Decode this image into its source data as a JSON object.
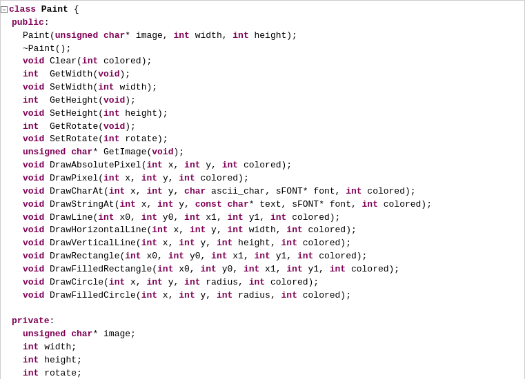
{
  "code": {
    "lines": [
      {
        "indent": 0,
        "collapse": true,
        "content": [
          {
            "t": "kw",
            "v": "class "
          },
          {
            "t": "class-name",
            "v": "Paint"
          },
          {
            "t": "plain",
            "v": " {"
          }
        ]
      },
      {
        "indent": 1,
        "content": [
          {
            "t": "kw",
            "v": "public"
          },
          {
            "t": "plain",
            "v": ":"
          }
        ]
      },
      {
        "indent": 2,
        "content": [
          {
            "t": "plain",
            "v": "Paint("
          },
          {
            "t": "kw",
            "v": "unsigned "
          },
          {
            "t": "kw",
            "v": "char"
          },
          {
            "t": "plain",
            "v": "* image, "
          },
          {
            "t": "kw",
            "v": "int"
          },
          {
            "t": "plain",
            "v": " width, "
          },
          {
            "t": "kw",
            "v": "int"
          },
          {
            "t": "plain",
            "v": " height);"
          }
        ]
      },
      {
        "indent": 2,
        "content": [
          {
            "t": "plain",
            "v": "~Paint();"
          }
        ]
      },
      {
        "indent": 2,
        "content": [
          {
            "t": "kw",
            "v": "void"
          },
          {
            "t": "plain",
            "v": " Clear("
          },
          {
            "t": "kw",
            "v": "int"
          },
          {
            "t": "plain",
            "v": " colored);"
          }
        ]
      },
      {
        "indent": 2,
        "content": [
          {
            "t": "kw",
            "v": "int"
          },
          {
            "t": "plain",
            "v": "  GetWidth("
          },
          {
            "t": "kw",
            "v": "void"
          },
          {
            "t": "plain",
            "v": ");"
          }
        ]
      },
      {
        "indent": 2,
        "content": [
          {
            "t": "kw",
            "v": "void"
          },
          {
            "t": "plain",
            "v": " SetWidth("
          },
          {
            "t": "kw",
            "v": "int"
          },
          {
            "t": "plain",
            "v": " width);"
          }
        ]
      },
      {
        "indent": 2,
        "content": [
          {
            "t": "kw",
            "v": "int"
          },
          {
            "t": "plain",
            "v": "  GetHeight("
          },
          {
            "t": "kw",
            "v": "void"
          },
          {
            "t": "plain",
            "v": ");"
          }
        ]
      },
      {
        "indent": 2,
        "content": [
          {
            "t": "kw",
            "v": "void"
          },
          {
            "t": "plain",
            "v": " SetHeight("
          },
          {
            "t": "kw",
            "v": "int"
          },
          {
            "t": "plain",
            "v": " height);"
          }
        ]
      },
      {
        "indent": 2,
        "content": [
          {
            "t": "kw",
            "v": "int"
          },
          {
            "t": "plain",
            "v": "  GetRotate("
          },
          {
            "t": "kw",
            "v": "void"
          },
          {
            "t": "plain",
            "v": ");"
          }
        ]
      },
      {
        "indent": 2,
        "content": [
          {
            "t": "kw",
            "v": "void"
          },
          {
            "t": "plain",
            "v": " SetRotate("
          },
          {
            "t": "kw",
            "v": "int"
          },
          {
            "t": "plain",
            "v": " rotate);"
          }
        ]
      },
      {
        "indent": 2,
        "content": [
          {
            "t": "kw",
            "v": "unsigned "
          },
          {
            "t": "kw",
            "v": "char"
          },
          {
            "t": "plain",
            "v": "* GetImage("
          },
          {
            "t": "kw",
            "v": "void"
          },
          {
            "t": "plain",
            "v": ");"
          }
        ]
      },
      {
        "indent": 2,
        "content": [
          {
            "t": "kw",
            "v": "void"
          },
          {
            "t": "plain",
            "v": " DrawAbsolutePixel("
          },
          {
            "t": "kw",
            "v": "int"
          },
          {
            "t": "plain",
            "v": " x, "
          },
          {
            "t": "kw",
            "v": "int"
          },
          {
            "t": "plain",
            "v": " y, "
          },
          {
            "t": "kw",
            "v": "int"
          },
          {
            "t": "plain",
            "v": " colored);"
          }
        ]
      },
      {
        "indent": 2,
        "content": [
          {
            "t": "kw",
            "v": "void"
          },
          {
            "t": "plain",
            "v": " DrawPixel("
          },
          {
            "t": "kw",
            "v": "int"
          },
          {
            "t": "plain",
            "v": " x, "
          },
          {
            "t": "kw",
            "v": "int"
          },
          {
            "t": "plain",
            "v": " y, "
          },
          {
            "t": "kw",
            "v": "int"
          },
          {
            "t": "plain",
            "v": " colored);"
          }
        ]
      },
      {
        "indent": 2,
        "content": [
          {
            "t": "kw",
            "v": "void"
          },
          {
            "t": "plain",
            "v": " DrawCharAt("
          },
          {
            "t": "kw",
            "v": "int"
          },
          {
            "t": "plain",
            "v": " x, "
          },
          {
            "t": "kw",
            "v": "int"
          },
          {
            "t": "plain",
            "v": " y, "
          },
          {
            "t": "kw",
            "v": "char"
          },
          {
            "t": "plain",
            "v": " ascii_char, sFONT* font, "
          },
          {
            "t": "kw",
            "v": "int"
          },
          {
            "t": "plain",
            "v": " colored);"
          }
        ]
      },
      {
        "indent": 2,
        "content": [
          {
            "t": "kw",
            "v": "void"
          },
          {
            "t": "plain",
            "v": " DrawStringAt("
          },
          {
            "t": "kw",
            "v": "int"
          },
          {
            "t": "plain",
            "v": " x, "
          },
          {
            "t": "kw",
            "v": "int"
          },
          {
            "t": "plain",
            "v": " y, "
          },
          {
            "t": "kw",
            "v": "const "
          },
          {
            "t": "kw",
            "v": "char"
          },
          {
            "t": "plain",
            "v": "* text, sFONT* font, "
          },
          {
            "t": "kw",
            "v": "int"
          },
          {
            "t": "plain",
            "v": " colored);"
          }
        ]
      },
      {
        "indent": 2,
        "content": [
          {
            "t": "kw",
            "v": "void"
          },
          {
            "t": "plain",
            "v": " DrawLine("
          },
          {
            "t": "kw",
            "v": "int"
          },
          {
            "t": "plain",
            "v": " x0, "
          },
          {
            "t": "kw",
            "v": "int"
          },
          {
            "t": "plain",
            "v": " y0, "
          },
          {
            "t": "kw",
            "v": "int"
          },
          {
            "t": "plain",
            "v": " x1, "
          },
          {
            "t": "kw",
            "v": "int"
          },
          {
            "t": "plain",
            "v": " y1, "
          },
          {
            "t": "kw",
            "v": "int"
          },
          {
            "t": "plain",
            "v": " colored);"
          }
        ]
      },
      {
        "indent": 2,
        "content": [
          {
            "t": "kw",
            "v": "void"
          },
          {
            "t": "plain",
            "v": " DrawHorizontalLine("
          },
          {
            "t": "kw",
            "v": "int"
          },
          {
            "t": "plain",
            "v": " x, "
          },
          {
            "t": "kw",
            "v": "int"
          },
          {
            "t": "plain",
            "v": " y, "
          },
          {
            "t": "kw",
            "v": "int"
          },
          {
            "t": "plain",
            "v": " width, "
          },
          {
            "t": "kw",
            "v": "int"
          },
          {
            "t": "plain",
            "v": " colored);"
          }
        ]
      },
      {
        "indent": 2,
        "content": [
          {
            "t": "kw",
            "v": "void"
          },
          {
            "t": "plain",
            "v": " DrawVerticalLine("
          },
          {
            "t": "kw",
            "v": "int"
          },
          {
            "t": "plain",
            "v": " x, "
          },
          {
            "t": "kw",
            "v": "int"
          },
          {
            "t": "plain",
            "v": " y, "
          },
          {
            "t": "kw",
            "v": "int"
          },
          {
            "t": "plain",
            "v": " height, "
          },
          {
            "t": "kw",
            "v": "int"
          },
          {
            "t": "plain",
            "v": " colored);"
          }
        ]
      },
      {
        "indent": 2,
        "content": [
          {
            "t": "kw",
            "v": "void"
          },
          {
            "t": "plain",
            "v": " DrawRectangle("
          },
          {
            "t": "kw",
            "v": "int"
          },
          {
            "t": "plain",
            "v": " x0, "
          },
          {
            "t": "kw",
            "v": "int"
          },
          {
            "t": "plain",
            "v": " y0, "
          },
          {
            "t": "kw",
            "v": "int"
          },
          {
            "t": "plain",
            "v": " x1, "
          },
          {
            "t": "kw",
            "v": "int"
          },
          {
            "t": "plain",
            "v": " y1, "
          },
          {
            "t": "kw",
            "v": "int"
          },
          {
            "t": "plain",
            "v": " colored);"
          }
        ]
      },
      {
        "indent": 2,
        "content": [
          {
            "t": "kw",
            "v": "void"
          },
          {
            "t": "plain",
            "v": " DrawFilledRectangle("
          },
          {
            "t": "kw",
            "v": "int"
          },
          {
            "t": "plain",
            "v": " x0, "
          },
          {
            "t": "kw",
            "v": "int"
          },
          {
            "t": "plain",
            "v": " y0, "
          },
          {
            "t": "kw",
            "v": "int"
          },
          {
            "t": "plain",
            "v": " x1, "
          },
          {
            "t": "kw",
            "v": "int"
          },
          {
            "t": "plain",
            "v": " y1, "
          },
          {
            "t": "kw",
            "v": "int"
          },
          {
            "t": "plain",
            "v": " colored);"
          }
        ]
      },
      {
        "indent": 2,
        "content": [
          {
            "t": "kw",
            "v": "void"
          },
          {
            "t": "plain",
            "v": " DrawCircle("
          },
          {
            "t": "kw",
            "v": "int"
          },
          {
            "t": "plain",
            "v": " x, "
          },
          {
            "t": "kw",
            "v": "int"
          },
          {
            "t": "plain",
            "v": " y, "
          },
          {
            "t": "kw",
            "v": "int"
          },
          {
            "t": "plain",
            "v": " radius, "
          },
          {
            "t": "kw",
            "v": "int"
          },
          {
            "t": "plain",
            "v": " colored);"
          }
        ]
      },
      {
        "indent": 2,
        "content": [
          {
            "t": "kw",
            "v": "void"
          },
          {
            "t": "plain",
            "v": " DrawFilledCircle("
          },
          {
            "t": "kw",
            "v": "int"
          },
          {
            "t": "plain",
            "v": " x, "
          },
          {
            "t": "kw",
            "v": "int"
          },
          {
            "t": "plain",
            "v": " y, "
          },
          {
            "t": "kw",
            "v": "int"
          },
          {
            "t": "plain",
            "v": " radius, "
          },
          {
            "t": "kw",
            "v": "int"
          },
          {
            "t": "plain",
            "v": " colored);"
          }
        ]
      },
      {
        "indent": 0,
        "content": []
      },
      {
        "indent": 1,
        "content": [
          {
            "t": "kw",
            "v": "private"
          },
          {
            "t": "plain",
            "v": ":"
          }
        ]
      },
      {
        "indent": 2,
        "content": [
          {
            "t": "kw",
            "v": "unsigned "
          },
          {
            "t": "kw",
            "v": "char"
          },
          {
            "t": "plain",
            "v": "* image;"
          }
        ]
      },
      {
        "indent": 2,
        "content": [
          {
            "t": "kw",
            "v": "int"
          },
          {
            "t": "plain",
            "v": " width;"
          }
        ]
      },
      {
        "indent": 2,
        "content": [
          {
            "t": "kw",
            "v": "int"
          },
          {
            "t": "plain",
            "v": " height;"
          }
        ]
      },
      {
        "indent": 2,
        "content": [
          {
            "t": "kw",
            "v": "int"
          },
          {
            "t": "plain",
            "v": " rotate;"
          }
        ]
      },
      {
        "indent": 0,
        "content": [
          {
            "t": "plain",
            "v": "};"
          }
        ]
      }
    ]
  }
}
